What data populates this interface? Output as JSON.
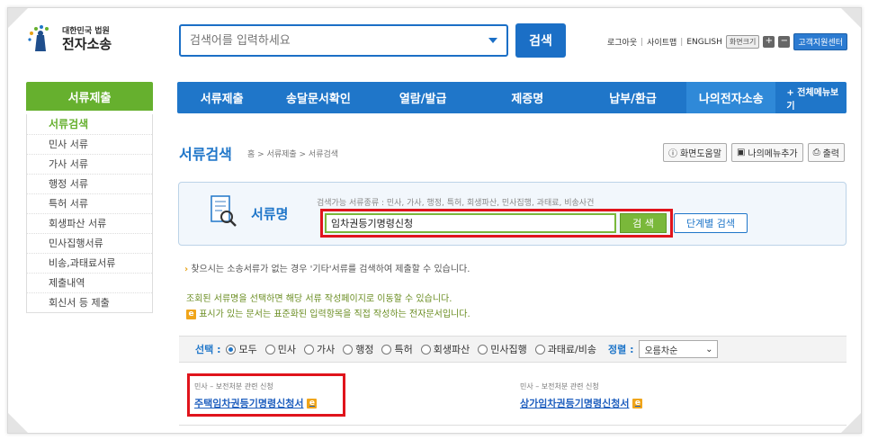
{
  "header": {
    "logo_sub": "대한민국 법원",
    "logo_main": "전자소송",
    "search_placeholder": "검색어를 입력하세요",
    "search_button": "검색",
    "logout": "로그아웃",
    "sitemap": "사이트맵",
    "english": "ENGLISH",
    "font_size": "화면크기",
    "zoom_in": "+",
    "zoom_out": "−",
    "help_center": "고객지원센터"
  },
  "left_menu_title": "서류제출",
  "topnav": {
    "items": [
      {
        "label": "서류제출"
      },
      {
        "label": "송달문서확인"
      },
      {
        "label": "열람/발급"
      },
      {
        "label": "제증명"
      },
      {
        "label": "납부/환급"
      },
      {
        "label": "나의전자소송"
      }
    ],
    "all_menu": "+ 전체메뉴보기"
  },
  "sidebar": {
    "items": [
      {
        "label": "서류검색"
      },
      {
        "label": "민사 서류"
      },
      {
        "label": "가사 서류"
      },
      {
        "label": "행정 서류"
      },
      {
        "label": "특허 서류"
      },
      {
        "label": "회생파산 서류"
      },
      {
        "label": "민사집행서류"
      },
      {
        "label": "비송,과태료서류"
      },
      {
        "label": "제출내역"
      },
      {
        "label": "회신서 등 제출"
      }
    ]
  },
  "page": {
    "title": "서류검색",
    "breadcrumb": "홈 > 서류제출 > 서류검색",
    "tools": {
      "help": "화면도움말",
      "my_menu": "나의메뉴추가",
      "print": "출력"
    }
  },
  "search_panel": {
    "label": "서류명",
    "hint": "검색가능 서류종류 : 민사, 가사, 행정, 특허, 회생파산, 민사집행, 과태료, 비송사건",
    "input_value": "임차권등기명령신청",
    "search_button": "검 색",
    "step_button": "단계별 검색"
  },
  "notes": {
    "note1": "찾으시는 소송서류가 없는 경우 '기타'서류를 검색하여 제출할 수 있습니다.",
    "note2": "조회된 서류명을 선택하면 해당 서류 작성페이지로 이동할 수 있습니다.",
    "note3": "표시가 있는 문서는 표준화된 입력항목을 직접 작성하는 전자문서입니다.",
    "e_icon": "e"
  },
  "filter": {
    "label": "선택 :",
    "options": [
      {
        "label": "모두",
        "selected": true
      },
      {
        "label": "민사",
        "selected": false
      },
      {
        "label": "가사",
        "selected": false
      },
      {
        "label": "행정",
        "selected": false
      },
      {
        "label": "특허",
        "selected": false
      },
      {
        "label": "회생파산",
        "selected": false
      },
      {
        "label": "민사집행",
        "selected": false
      },
      {
        "label": "과태료/비송",
        "selected": false
      }
    ],
    "sort_label": "정렬 :",
    "sort_value": "오름차순"
  },
  "results": [
    {
      "category": "민사 – 보전처분 관련 신청",
      "title": "주택임차권등기명령신청서"
    },
    {
      "category": "민사 – 보전처분 관련 신청",
      "title": "상가임차권등기명령신청서"
    }
  ],
  "colors": {
    "brand_blue": "#1f76c9",
    "green": "#66b02e",
    "highlight_red": "#e0141c"
  }
}
